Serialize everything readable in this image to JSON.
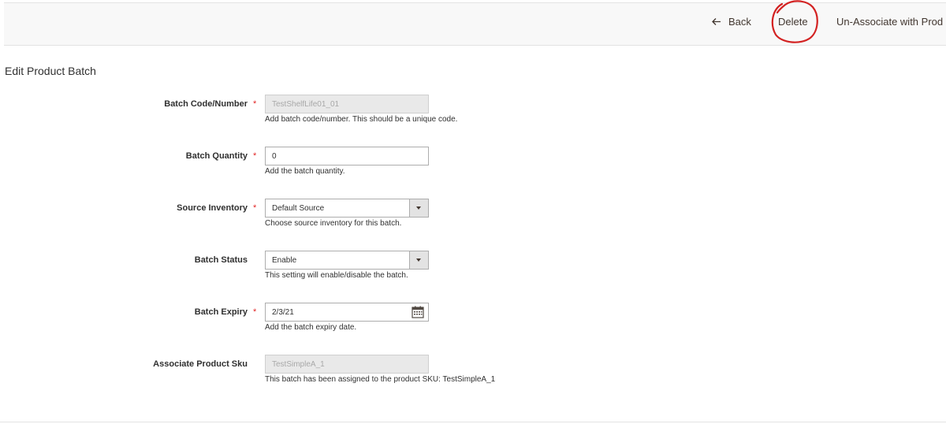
{
  "header": {
    "back_label": "Back",
    "delete_label": "Delete",
    "unassociate_label": "Un-Associate with Prod"
  },
  "page_title": "Edit Product Batch",
  "form": {
    "batch_code": {
      "label": "Batch Code/Number",
      "value": "TestShelfLife01_01",
      "note": "Add batch code/number. This should be a unique code.",
      "required": true,
      "disabled": true
    },
    "batch_quantity": {
      "label": "Batch Quantity",
      "value": "0",
      "note": "Add the batch quantity.",
      "required": true
    },
    "source_inventory": {
      "label": "Source Inventory",
      "value": "Default Source",
      "note": "Choose source inventory for this batch.",
      "required": true
    },
    "batch_status": {
      "label": "Batch Status",
      "value": "Enable",
      "note": "This setting will enable/disable the batch.",
      "required": false
    },
    "batch_expiry": {
      "label": "Batch Expiry",
      "value": "2/3/21",
      "note": "Add the batch expiry date.",
      "required": true
    },
    "associate_sku": {
      "label": "Associate Product Sku",
      "value": "TestSimpleA_1",
      "note": "This batch has been assigned to the product SKU: TestSimpleA_1",
      "required": false,
      "disabled": true
    },
    "required_marker": "*"
  },
  "icons": {
    "back": "arrow-left-icon",
    "select": "chevron-down-icon",
    "date": "calendar-icon"
  },
  "colors": {
    "required_star": "#e22626",
    "annotation": "#d32222",
    "header_bg": "#f8f8f8"
  }
}
